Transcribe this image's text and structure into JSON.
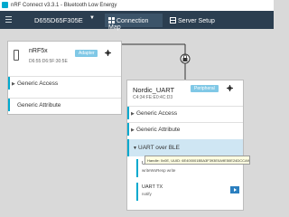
{
  "window": {
    "title": "nRF Connect v3.3.1 - Bluetooth Low Energy"
  },
  "nav": {
    "device": "D655D65F305E",
    "tabs": [
      {
        "label": "Connection Map",
        "active": true,
        "icon": "connection-map-icon"
      },
      {
        "label": "Server Setup",
        "active": false,
        "icon": "server-setup-icon"
      }
    ]
  },
  "adapter": {
    "name": "nRF5x",
    "address": "D6:55:D6:5F:30:5E",
    "badge": "Adapter",
    "services": [
      "Generic Access",
      "Generic Attribute"
    ]
  },
  "peripheral": {
    "name": "Nordic_UART",
    "address": "C4:34:FE:E0:4C:D3",
    "badge": "Peripheral",
    "services": [
      "Generic Access",
      "Generic Attribute"
    ],
    "uart": {
      "label": "UART over BLE",
      "rx": {
        "name": "UART RX",
        "props": "writeWoResp  write"
      },
      "tx": {
        "name": "UART TX",
        "props": "notify"
      },
      "tooltip": "Handle: 0x0E, UUID: 6E400001B5A3F393E0A9E50E24DCCA9E"
    }
  },
  "colors": {
    "accent": "#00a9ce",
    "nav": "#2b3e50",
    "badge": "#80c8e6"
  }
}
